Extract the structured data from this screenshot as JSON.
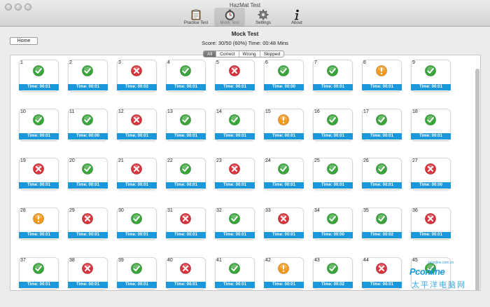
{
  "window": {
    "title": "HazMat Test"
  },
  "toolbar": {
    "items": [
      {
        "label": "Practice Test",
        "icon": "clipboard-icon",
        "active": false
      },
      {
        "label": "Mock Test",
        "icon": "stopwatch-icon",
        "active": true
      },
      {
        "label": "Settings",
        "icon": "gear-icon",
        "active": false
      },
      {
        "label": "About",
        "icon": "info-icon",
        "active": false
      }
    ]
  },
  "home_button": {
    "label": "Home"
  },
  "page": {
    "title": "Mock Test",
    "score": "Score: 30/50 (60%) Time: 00:48 Mins"
  },
  "filters": {
    "options": [
      "All",
      "Correct",
      "Wrong",
      "Skipped"
    ],
    "selected": "All"
  },
  "colors": {
    "correct": "#3aa53b",
    "wrong": "#d9333c",
    "skipped": "#f09a22",
    "time_bar": "#1b98dc"
  },
  "questions": [
    {
      "number": "1",
      "status": "correct",
      "time": "Time: 00:01"
    },
    {
      "number": "2",
      "status": "correct",
      "time": "Time: 00:01"
    },
    {
      "number": "3",
      "status": "wrong",
      "time": "Time: 00:02"
    },
    {
      "number": "4",
      "status": "correct",
      "time": "Time: 00:01"
    },
    {
      "number": "5",
      "status": "wrong",
      "time": "Time: 00:01"
    },
    {
      "number": "6",
      "status": "correct",
      "time": "Time: 00:00"
    },
    {
      "number": "7",
      "status": "correct",
      "time": "Time: 00:01"
    },
    {
      "number": "8",
      "status": "skipped",
      "time": "Time: 00:01"
    },
    {
      "number": "9",
      "status": "correct",
      "time": "Time: 00:01"
    },
    {
      "number": "10",
      "status": "correct",
      "time": "Time: 00:01"
    },
    {
      "number": "11",
      "status": "correct",
      "time": "Time: 00:00"
    },
    {
      "number": "12",
      "status": "wrong",
      "time": "Time: 00:01"
    },
    {
      "number": "13",
      "status": "correct",
      "time": "Time: 00:01"
    },
    {
      "number": "14",
      "status": "correct",
      "time": "Time: 00:01"
    },
    {
      "number": "15",
      "status": "skipped",
      "time": "Time: 00:01"
    },
    {
      "number": "16",
      "status": "correct",
      "time": "Time: 00:01"
    },
    {
      "number": "17",
      "status": "correct",
      "time": "Time: 00:01"
    },
    {
      "number": "18",
      "status": "correct",
      "time": "Time: 00:01"
    },
    {
      "number": "19",
      "status": "wrong",
      "time": "Time: 00:01"
    },
    {
      "number": "20",
      "status": "correct",
      "time": "Time: 00:01"
    },
    {
      "number": "21",
      "status": "wrong",
      "time": "Time: 00:01"
    },
    {
      "number": "22",
      "status": "correct",
      "time": "Time: 00:01"
    },
    {
      "number": "23",
      "status": "wrong",
      "time": "Time: 00:01"
    },
    {
      "number": "24",
      "status": "correct",
      "time": "Time: 00:01"
    },
    {
      "number": "25",
      "status": "correct",
      "time": "Time: 00:01"
    },
    {
      "number": "26",
      "status": "correct",
      "time": "Time: 00:01"
    },
    {
      "number": "27",
      "status": "wrong",
      "time": "Time: 00:00"
    },
    {
      "number": "28",
      "status": "skipped",
      "time": "Time: 00:01"
    },
    {
      "number": "29",
      "status": "wrong",
      "time": "Time: 00:01"
    },
    {
      "number": "30",
      "status": "correct",
      "time": "Time: 00:01"
    },
    {
      "number": "31",
      "status": "wrong",
      "time": "Time: 00:01"
    },
    {
      "number": "32",
      "status": "correct",
      "time": "Time: 00:01"
    },
    {
      "number": "33",
      "status": "wrong",
      "time": "Time: 00:01"
    },
    {
      "number": "34",
      "status": "correct",
      "time": "Time: 00:00"
    },
    {
      "number": "35",
      "status": "correct",
      "time": "Time: 00:02"
    },
    {
      "number": "36",
      "status": "wrong",
      "time": "Time: 00:01"
    },
    {
      "number": "37",
      "status": "correct",
      "time": "Time: 00:01"
    },
    {
      "number": "38",
      "status": "wrong",
      "time": "Time: 00:01"
    },
    {
      "number": "39",
      "status": "correct",
      "time": "Time: 00:01"
    },
    {
      "number": "40",
      "status": "wrong",
      "time": "Time: 00:01"
    },
    {
      "number": "41",
      "status": "correct",
      "time": "Time: 00:01"
    },
    {
      "number": "42",
      "status": "skipped",
      "time": "Time: 00:01"
    },
    {
      "number": "43",
      "status": "correct",
      "time": "Time: 00:02"
    },
    {
      "number": "44",
      "status": "wrong",
      "time": "Time: 00:01"
    },
    {
      "number": "45",
      "status": "correct",
      "time": ""
    }
  ],
  "watermark": {
    "text": "Pconline",
    "url": "pconline.com.cn",
    "cn_text": "太平洋电脑网"
  }
}
